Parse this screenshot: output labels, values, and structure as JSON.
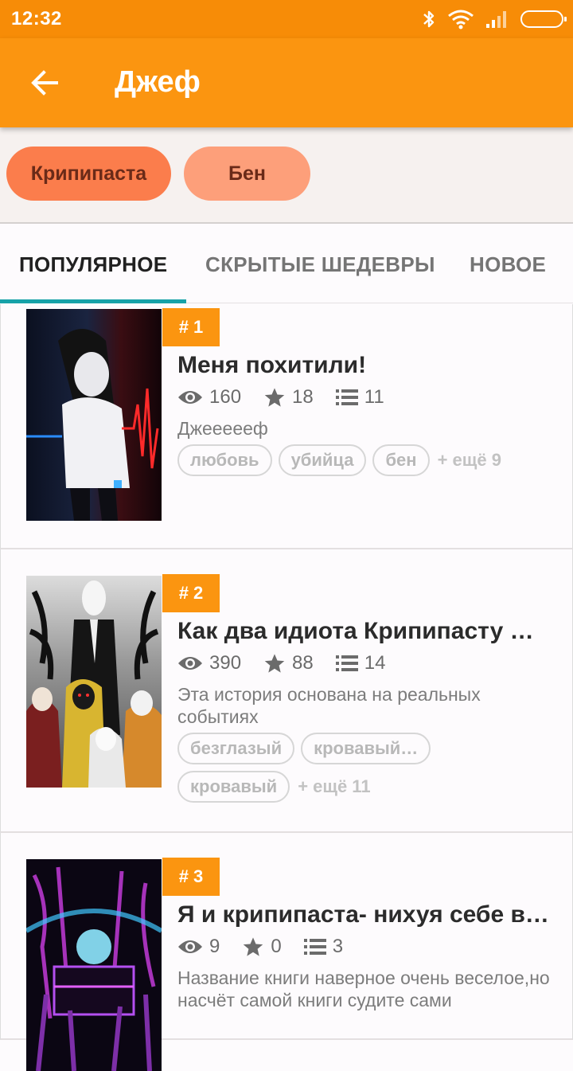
{
  "status_bar": {
    "time": "12:32"
  },
  "app_bar": {
    "title": "Джеф"
  },
  "chips": [
    "Крипипаста",
    "Бен"
  ],
  "tabs": [
    {
      "label": "ПОПУЛЯРНОЕ",
      "active": true
    },
    {
      "label": "СКРЫТЫЕ ШЕДЕВРЫ",
      "active": false
    },
    {
      "label": "НОВОЕ",
      "active": false
    }
  ],
  "stories": [
    {
      "rank": "# 1",
      "title": "Меня похитили!",
      "views": "160",
      "stars": "18",
      "parts": "11",
      "description": "Джеееееф",
      "tags": [
        "любовь",
        "убийца",
        "бен"
      ],
      "more": "+ ещё 9"
    },
    {
      "rank": "# 2",
      "title": "Как два идиота Крипипасту …",
      "views": "390",
      "stars": "88",
      "parts": "14",
      "description": "Эта история основана на реальных событиях",
      "tags": [
        "безглазый",
        "кровавый…",
        "кровавый"
      ],
      "more": "+ ещё 11"
    },
    {
      "rank": "# 3",
      "title": "Я и крипипаста- нихуя себе в…",
      "views": "9",
      "stars": "0",
      "parts": "3",
      "description": "Название книги наверное очень веселое,но насчёт самой книги судите сами",
      "tags": [],
      "more": ""
    }
  ],
  "colors": {
    "accent": "#fb9510",
    "status": "#f78c07",
    "tab_indicator": "#17a2a8",
    "chip_primary": "#fb7d4c",
    "chip_secondary": "#fd9f7a"
  }
}
